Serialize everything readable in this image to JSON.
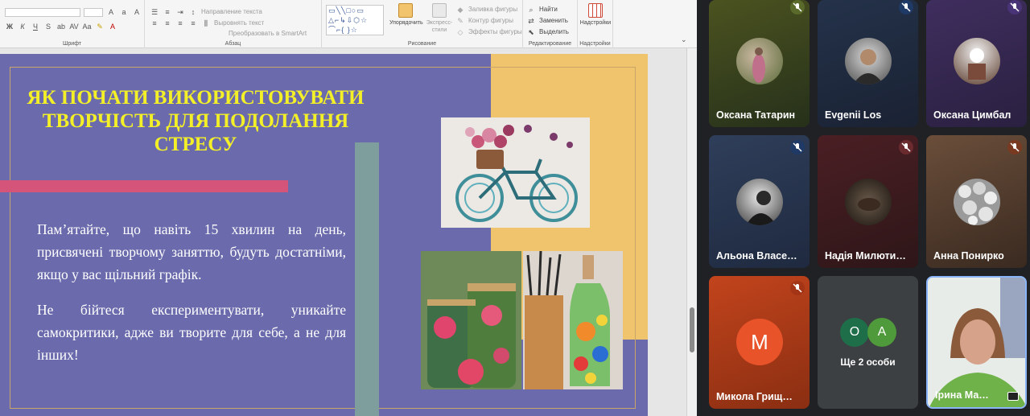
{
  "ribbon": {
    "font_group_label": "Шрифт",
    "paragraph_group_label": "Абзац",
    "drawing_group_label": "Рисование",
    "editing_group_label": "Редактирование",
    "addins_group_label": "Надстройки",
    "text_direction": "Направление текста",
    "align_text": "Выровнять текст",
    "convert_smartart": "Преобразовать в SmartArt",
    "arrange_label": "Упорядочить",
    "quick_styles_label": "Экспресс-стили",
    "shape_fill": "Заливка фигуры",
    "shape_outline": "Контур фигуры",
    "shape_effects": "Эффекты фигуры",
    "find": "Найти",
    "replace": "Заменить",
    "select": "Выделить",
    "addins_button": "Надстройки"
  },
  "slide": {
    "title": "ЯК ПОЧАТИ ВИКОРИСТОВУВАТИ ТВОРЧІСТЬ ДЛЯ ПОДОЛАННЯ СТРЕСУ",
    "paragraph1": "Пам’ятайте, що навіть 15 хвилин на день, присвячені творчому заняттю, будуть достатніми, якщо у вас щільний графік.",
    "paragraph2": "Не бійтеся експериментувати, уникайте самокритики, адже ви творите для себе, а не для інших!"
  },
  "participants": [
    {
      "name": "Оксана Татарин",
      "muted": true
    },
    {
      "name": "Evgenii Los",
      "muted": true
    },
    {
      "name": "Оксана Цимбал",
      "muted": true
    },
    {
      "name": "Альона Власе…",
      "muted": true
    },
    {
      "name": "Надія Милюти…",
      "muted": true
    },
    {
      "name": "Анна Понирко",
      "muted": true
    },
    {
      "name": "Микола Грищ…",
      "muted": true,
      "initial": "М"
    },
    {
      "name": "Ірина Ма…",
      "muted": false
    }
  ],
  "others": {
    "label": "Ще 2 особи",
    "initials": [
      "О",
      "А"
    ]
  },
  "colors": {
    "slide_bg": "#6a6aac",
    "slide_yellow": "#efc46c",
    "title_text": "#f4f028",
    "accent_pink": "#d4547a",
    "teal": "#7d9e9c",
    "meet_bg": "#202124"
  }
}
